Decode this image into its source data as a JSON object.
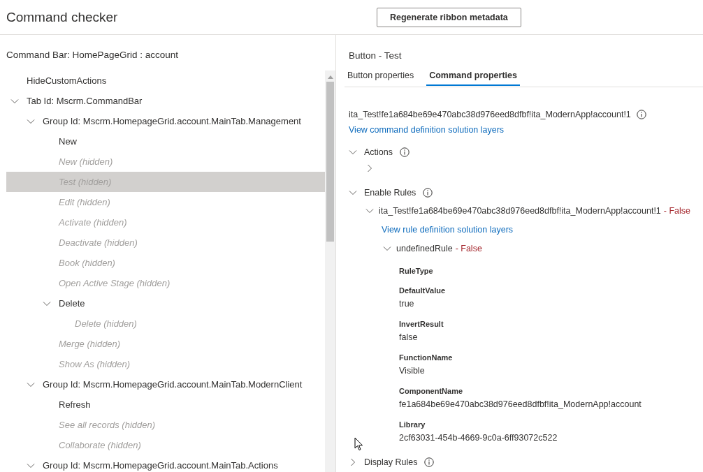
{
  "header": {
    "title": "Command checker",
    "button": "Regenerate ribbon metadata"
  },
  "left": {
    "title": "Command Bar: HomePageGrid : account",
    "tree": [
      {
        "label": "HideCustomActions",
        "hidden": false,
        "selected": false
      },
      {
        "label": "Tab Id: Mscrm.CommandBar",
        "hidden": false,
        "selected": false,
        "expanded": true,
        "children": [
          {
            "label": "Group Id: Mscrm.HomepageGrid.account.MainTab.Management",
            "hidden": false,
            "selected": false,
            "expanded": true,
            "children": [
              {
                "label": "New",
                "hidden": false,
                "selected": false
              },
              {
                "label": "New (hidden)",
                "hidden": true,
                "selected": false
              },
              {
                "label": "Test (hidden)",
                "hidden": true,
                "selected": true
              },
              {
                "label": "Edit (hidden)",
                "hidden": true,
                "selected": false
              },
              {
                "label": "Activate (hidden)",
                "hidden": true,
                "selected": false
              },
              {
                "label": "Deactivate (hidden)",
                "hidden": true,
                "selected": false
              },
              {
                "label": "Book (hidden)",
                "hidden": true,
                "selected": false
              },
              {
                "label": "Open Active Stage (hidden)",
                "hidden": true,
                "selected": false
              },
              {
                "label": "Delete",
                "hidden": false,
                "selected": false,
                "expanded": true,
                "children": [
                  {
                    "label": "Delete (hidden)",
                    "hidden": true,
                    "selected": false
                  }
                ]
              },
              {
                "label": "Merge (hidden)",
                "hidden": true,
                "selected": false
              },
              {
                "label": "Show As (hidden)",
                "hidden": true,
                "selected": false
              }
            ]
          },
          {
            "label": "Group Id: Mscrm.HomepageGrid.account.MainTab.ModernClient",
            "hidden": false,
            "selected": false,
            "expanded": true,
            "children": [
              {
                "label": "Refresh",
                "hidden": false,
                "selected": false
              },
              {
                "label": "See all records (hidden)",
                "hidden": true,
                "selected": false
              },
              {
                "label": "Collaborate (hidden)",
                "hidden": true,
                "selected": false
              }
            ]
          },
          {
            "label": "Group Id: Mscrm.HomepageGrid.account.MainTab.Actions",
            "hidden": false,
            "selected": false,
            "expanded": true
          }
        ]
      }
    ]
  },
  "right": {
    "title": "Button - Test",
    "tabs": [
      {
        "label": "Button properties",
        "selected": false
      },
      {
        "label": "Command properties",
        "selected": true
      }
    ],
    "command_id": "ita_Test!fe1a684be69e470abc38d976eed8dfbf!ita_ModernApp!account!1",
    "command_link": "View command definition solution layers",
    "sections": [
      {
        "kind": "actions",
        "title": "Actions",
        "expanded": true,
        "items": [
          {
            "expanded": false
          }
        ]
      },
      {
        "kind": "rules",
        "title": "Enable Rules",
        "expanded": true,
        "rules": [
          {
            "name": "ita_Test!fe1a684be69e470abc38d976eed8dfbf!ita_ModernApp!account!1",
            "result": "- False",
            "expanded": true,
            "link": "View rule definition solution layers",
            "children": [
              {
                "name": "undefinedRule",
                "result": "- False",
                "expanded": true,
                "properties": [
                  {
                    "label": "RuleType"
                  },
                  {
                    "label": "DefaultValue",
                    "value": "true"
                  },
                  {
                    "label": "InvertResult",
                    "value": "false"
                  },
                  {
                    "label": "FunctionName",
                    "value": "Visible"
                  },
                  {
                    "label": "ComponentName",
                    "value": "fe1a684be69e470abc38d976eed8dfbf!ita_ModernApp!account"
                  },
                  {
                    "label": "Library",
                    "value": "2cf63031-454b-4669-9c0a-6ff93072c522"
                  }
                ]
              }
            ]
          }
        ]
      },
      {
        "kind": "rules",
        "title": "Display Rules",
        "expanded": false
      }
    ]
  }
}
